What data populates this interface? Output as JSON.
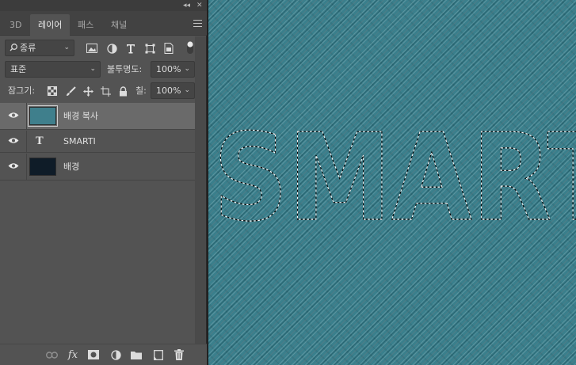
{
  "topstrip": {
    "collapse_label": "◂◂",
    "close_label": "✕"
  },
  "tabs": [
    {
      "label": "3D",
      "active": false
    },
    {
      "label": "레이어",
      "active": true
    },
    {
      "label": "패스",
      "active": false
    },
    {
      "label": "채널",
      "active": false
    }
  ],
  "filter": {
    "kind_label": "종류",
    "icons": [
      "image-filter-icon",
      "adjustment-filter-icon",
      "type-filter-icon",
      "shape-filter-icon",
      "smart-object-filter-icon",
      "filter-toggle-icon"
    ]
  },
  "blend": {
    "mode": "표준",
    "opacity_label": "불투명도:",
    "opacity_value": "100%"
  },
  "lock": {
    "label": "잠그기:",
    "fill_label": "칠:",
    "fill_value": "100%",
    "icons": [
      "lock-transparent-icon",
      "lock-image-icon",
      "lock-position-icon",
      "lock-artboard-icon",
      "lock-all-icon"
    ]
  },
  "layers": [
    {
      "name": "배경 복사",
      "type": "pixel",
      "selected": true,
      "thumb_color": "#3f7f8c"
    },
    {
      "name": "SMARTI",
      "type": "text",
      "selected": false,
      "type_glyph": "T"
    },
    {
      "name": "배경",
      "type": "pixel",
      "selected": false,
      "thumb_color": "#0f1c28"
    }
  ],
  "bottom_icons": [
    "link-layers-icon",
    "fx-icon",
    "layer-mask-icon",
    "adjustment-layer-icon",
    "new-group-icon",
    "new-layer-icon",
    "delete-layer-icon"
  ],
  "bottom_fx_label": "fx",
  "canvas": {
    "selection_text": "SMARTI",
    "fill_color": "#3a7f8c"
  }
}
